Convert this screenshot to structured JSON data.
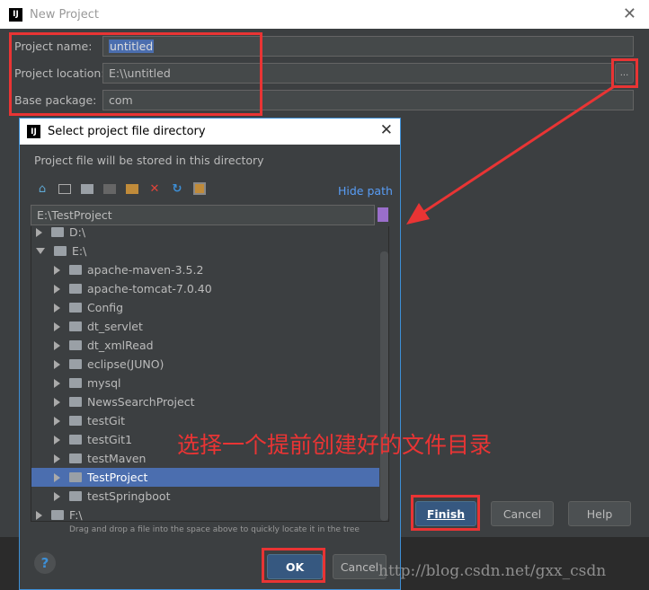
{
  "outer": {
    "title": "New Project",
    "fields": [
      {
        "label": "Project name:",
        "value": "untitled"
      },
      {
        "label": "Project location:",
        "value": "E:\\\\untitled"
      },
      {
        "label": "Base package:",
        "value": "com"
      }
    ],
    "browse_label": "...",
    "finish": "Finish",
    "cancel": "Cancel",
    "help": "Help"
  },
  "dialog": {
    "title": "Select project file directory",
    "subtitle": "Project file will be stored in this directory",
    "hide_path": "Hide path",
    "path": "E:\\TestProject",
    "tree": [
      {
        "label": "D:\\",
        "level": 0,
        "expanded": false
      },
      {
        "label": "E:\\",
        "level": 0,
        "expanded": true
      },
      {
        "label": "apache-maven-3.5.2",
        "level": 1
      },
      {
        "label": "apache-tomcat-7.0.40",
        "level": 1
      },
      {
        "label": "Config",
        "level": 1
      },
      {
        "label": "dt_servlet",
        "level": 1
      },
      {
        "label": "dt_xmlRead",
        "level": 1
      },
      {
        "label": "eclipse(JUNO)",
        "level": 1
      },
      {
        "label": "mysql",
        "level": 1
      },
      {
        "label": "NewsSearchProject",
        "level": 1
      },
      {
        "label": "testGit",
        "level": 1
      },
      {
        "label": "testGit1",
        "level": 1
      },
      {
        "label": "testMaven",
        "level": 1
      },
      {
        "label": "TestProject",
        "level": 1,
        "selected": true
      },
      {
        "label": "testSpringboot",
        "level": 1
      },
      {
        "label": "F:\\",
        "level": 0,
        "expanded": false
      }
    ],
    "hint": "Drag and drop a file into the space above to quickly locate it in the tree",
    "ok": "OK",
    "cancel": "Cancel"
  },
  "annotation": "选择一个提前创建好的文件目录",
  "watermark": "http://blog.csdn.net/gxx_csdn",
  "colors": {
    "annotation": "#e93434",
    "selection": "#4b6eaf"
  }
}
